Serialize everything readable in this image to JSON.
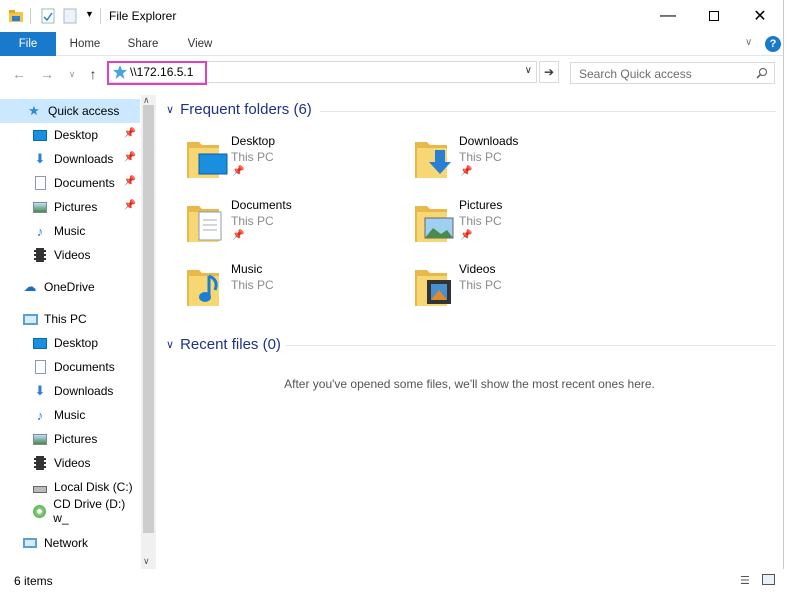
{
  "window": {
    "title": "File Explorer"
  },
  "ribbon": {
    "tabs": [
      "File",
      "Home",
      "Share",
      "View"
    ],
    "help": "?"
  },
  "address": {
    "value": "\\\\172.16.5.1"
  },
  "search": {
    "placeholder": "Search Quick access"
  },
  "nav": {
    "quick_access": "Quick access",
    "qa_items": [
      "Desktop",
      "Downloads",
      "Documents",
      "Pictures",
      "Music",
      "Videos"
    ],
    "onedrive": "OneDrive",
    "this_pc": "This PC",
    "pc_items": [
      "Desktop",
      "Documents",
      "Downloads",
      "Music",
      "Pictures",
      "Videos",
      "Local Disk (C:)",
      "CD Drive (D:) w_"
    ],
    "network": "Network"
  },
  "content": {
    "frequent_header": "Frequent folders (6)",
    "folders": [
      {
        "name": "Desktop",
        "location": "This PC"
      },
      {
        "name": "Downloads",
        "location": "This PC"
      },
      {
        "name": "Documents",
        "location": "This PC"
      },
      {
        "name": "Pictures",
        "location": "This PC"
      },
      {
        "name": "Music",
        "location": "This PC"
      },
      {
        "name": "Videos",
        "location": "This PC"
      }
    ],
    "recent_header": "Recent files (0)",
    "recent_empty": "After you've opened some files, we'll show the most recent ones here."
  },
  "status": {
    "count": "6 items"
  },
  "colors": {
    "accent": "#1979ca",
    "selection": "#cce8ff",
    "highlight": "#e040c0",
    "header": "#1e3287"
  }
}
